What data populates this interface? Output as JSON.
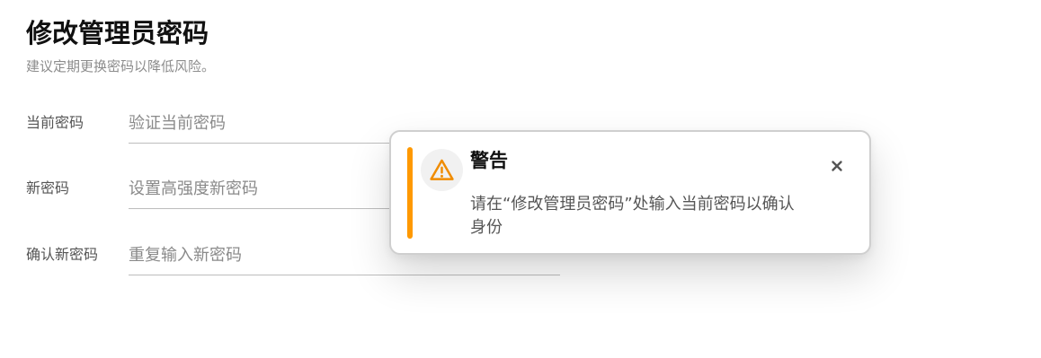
{
  "header": {
    "title": "修改管理员密码",
    "subtitle": "建议定期更换密码以降低风险。"
  },
  "form": {
    "fields": [
      {
        "label": "当前密码",
        "placeholder": "验证当前密码"
      },
      {
        "label": "新密码",
        "placeholder": "设置高强度新密码"
      },
      {
        "label": "确认新密码",
        "placeholder": "重复输入新密码"
      }
    ]
  },
  "toast": {
    "title": "警告",
    "message": "请在“修改管理员密码”处输入当前密码以确认身份",
    "icon": "warning-icon",
    "close_icon": "close-icon",
    "accent_color": "#ff9900"
  }
}
